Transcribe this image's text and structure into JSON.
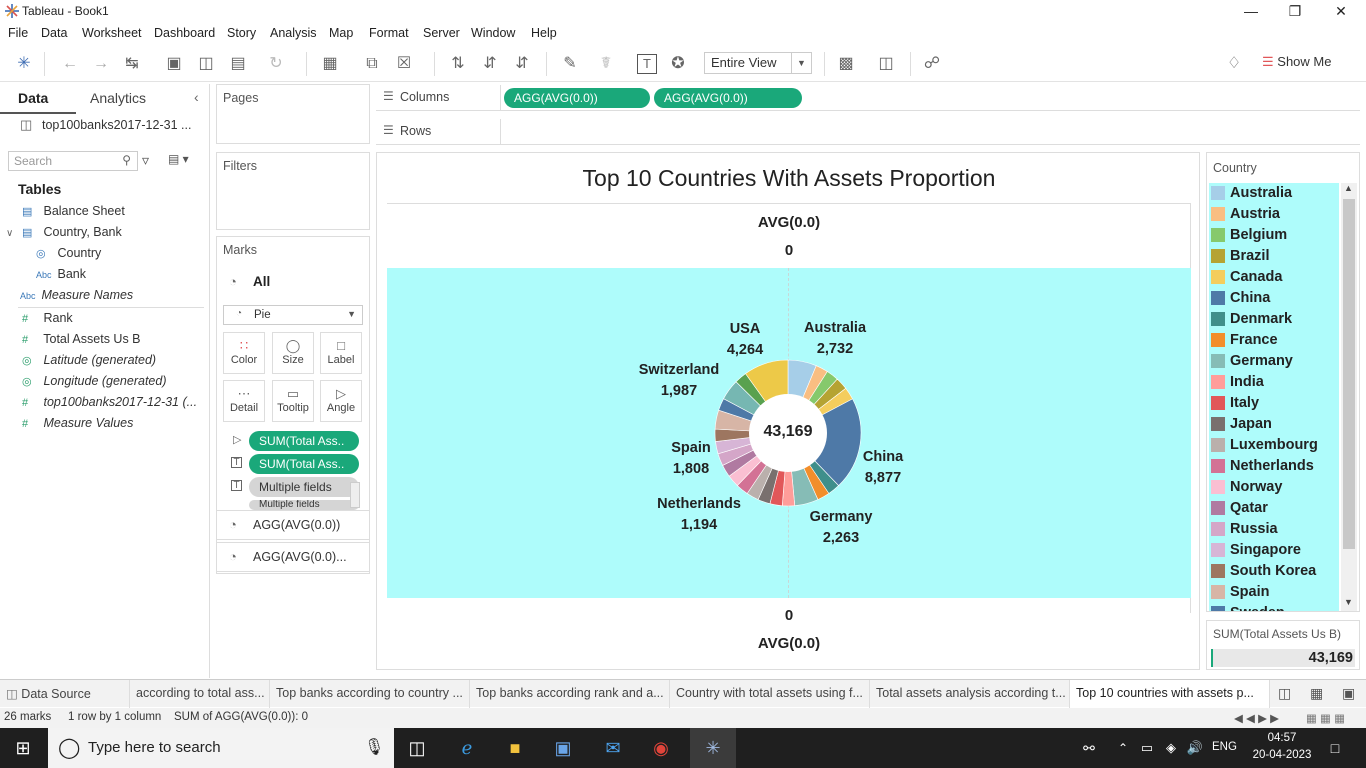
{
  "window": {
    "title": "Tableau - Book1"
  },
  "menu": [
    "File",
    "Data",
    "Worksheet",
    "Dashboard",
    "Story",
    "Analysis",
    "Map",
    "Format",
    "Server",
    "Window",
    "Help"
  ],
  "toolbar": {
    "view_select": "Entire View",
    "show_me": "Show Me"
  },
  "data_pane": {
    "tabs": [
      "Data",
      "Analytics"
    ],
    "datasource": "top100banks2017-12-31 ...",
    "search_placeholder": "Search",
    "tables_heading": "Tables",
    "fields": [
      {
        "label": "Balance Sheet"
      },
      {
        "label": "Country, Bank"
      },
      {
        "label": "Country"
      },
      {
        "label": "Bank"
      },
      {
        "label": "Measure Names"
      },
      {
        "label": "Rank"
      },
      {
        "label": "Total Assets Us B"
      },
      {
        "label": "Latitude (generated)"
      },
      {
        "label": "Longitude (generated)"
      },
      {
        "label": "top100banks2017-12-31 (..."
      },
      {
        "label": "Measure Values"
      }
    ]
  },
  "pages": {
    "title": "Pages"
  },
  "filters": {
    "title": "Filters"
  },
  "marks": {
    "title": "Marks",
    "all_label": "All",
    "mark_type": "Pie",
    "buttons": [
      "Color",
      "Size",
      "Label",
      "Detail",
      "Tooltip",
      "Angle"
    ],
    "pills": [
      "SUM(Total Ass..",
      "SUM(Total Ass..",
      "Multiple fields",
      "Multiple fields"
    ],
    "layers": [
      "AGG(AVG(0.0))",
      "AGG(AVG(0.0)..."
    ]
  },
  "shelves": {
    "columns_label": "Columns",
    "rows_label": "Rows",
    "columns_pills": [
      "AGG(AVG(0.0))",
      "AGG(AVG(0.0))"
    ]
  },
  "view": {
    "title": "Top 10 Countries With Assets Proportion",
    "top_header": "AVG(0.0)",
    "top_value": "0",
    "bottom_value": "0",
    "bottom_header": "AVG(0.0)",
    "center_total": "43,169"
  },
  "chart_data": {
    "type": "pie",
    "title": "Top 10 Countries With Assets Proportion",
    "total": 43169,
    "labeled": [
      {
        "country": "Australia",
        "value": 2732
      },
      {
        "country": "China",
        "value": 8877
      },
      {
        "country": "Germany",
        "value": 2263
      },
      {
        "country": "Netherlands",
        "value": 1194
      },
      {
        "country": "Spain",
        "value": 1808
      },
      {
        "country": "Switzerland",
        "value": 1987
      },
      {
        "country": "USA",
        "value": 4264
      }
    ],
    "labels_text": [
      {
        "name": "Australia",
        "value": "2,732"
      },
      {
        "name": "China",
        "value": "8,877"
      },
      {
        "name": "Germany",
        "value": "2,263"
      },
      {
        "name": "Netherlands",
        "value": "1,194"
      },
      {
        "name": "Spain",
        "value": "1,808"
      },
      {
        "name": "Switzerland",
        "value": "1,987"
      },
      {
        "name": "USA",
        "value": "4,264"
      }
    ]
  },
  "legend": {
    "title": "Country",
    "items": [
      {
        "name": "Australia",
        "color": "#a6cee8"
      },
      {
        "name": "Austria",
        "color": "#f9be82"
      },
      {
        "name": "Belgium",
        "color": "#86c96c"
      },
      {
        "name": "Brazil",
        "color": "#b5a333"
      },
      {
        "name": "Canada",
        "color": "#f4cd5d"
      },
      {
        "name": "China",
        "color": "#4e79a7"
      },
      {
        "name": "Denmark",
        "color": "#3f8f8b"
      },
      {
        "name": "France",
        "color": "#f28e2b"
      },
      {
        "name": "Germany",
        "color": "#86bcb6"
      },
      {
        "name": "India",
        "color": "#ff9d9a"
      },
      {
        "name": "Italy",
        "color": "#e15759"
      },
      {
        "name": "Japan",
        "color": "#79706e"
      },
      {
        "name": "Luxembourg",
        "color": "#bab0ac"
      },
      {
        "name": "Netherlands",
        "color": "#d37295"
      },
      {
        "name": "Norway",
        "color": "#fabfd2"
      },
      {
        "name": "Qatar",
        "color": "#b07aa1"
      },
      {
        "name": "Russia",
        "color": "#d4a6c8"
      },
      {
        "name": "Singapore",
        "color": "#d7b5d6"
      },
      {
        "name": "South Korea",
        "color": "#9d7660"
      },
      {
        "name": "Spain",
        "color": "#d7b5a6"
      },
      {
        "name": "Sweden",
        "color": "#4e79a7"
      }
    ],
    "size_title": "SUM(Total Assets Us B)",
    "size_value": "43,169"
  },
  "sheet_tabs": {
    "data_source": "Data Source",
    "tabs": [
      "according to total ass...",
      "Top banks according to country ...",
      "Top banks according rank and a...",
      "Country with total assets using f...",
      "Total assets analysis according t...",
      "Top 10 countries with assets p..."
    ]
  },
  "status": {
    "marks": "26 marks",
    "dims": "1 row by 1 column",
    "sum": "SUM of AGG(AVG(0.0)): 0"
  },
  "taskbar": {
    "search_placeholder": "Type here to search",
    "lang": "ENG",
    "time": "04:57",
    "date": "20-04-2023"
  }
}
